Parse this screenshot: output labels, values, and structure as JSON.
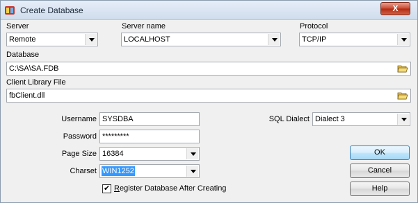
{
  "window": {
    "title": "Create Database",
    "close_label": "X"
  },
  "server": {
    "label": "Server",
    "value": "Remote"
  },
  "server_name": {
    "label": "Server name",
    "value": "LOCALHOST"
  },
  "protocol": {
    "label": "Protocol",
    "value": "TCP/IP"
  },
  "database": {
    "label": "Database",
    "value": "C:\\SA\\SA.FDB"
  },
  "client_library": {
    "label": "Client Library File",
    "value": "fbClient.dll"
  },
  "username": {
    "label": "Username",
    "value": "SYSDBA"
  },
  "password": {
    "label": "Password",
    "value": "*********"
  },
  "page_size": {
    "label": "Page Size",
    "value": "16384"
  },
  "charset": {
    "label": "Charset",
    "value": "WIN1252"
  },
  "sql_dialect": {
    "label": "SQL Dialect",
    "value": "Dialect 3"
  },
  "register": {
    "label_first": "R",
    "label_rest": "egister Database After Creating",
    "checked": true
  },
  "buttons": {
    "ok": "OK",
    "cancel": "Cancel",
    "help": "Help"
  },
  "icons": {
    "app": "database-app-icon",
    "folder": "folder-open-icon"
  }
}
